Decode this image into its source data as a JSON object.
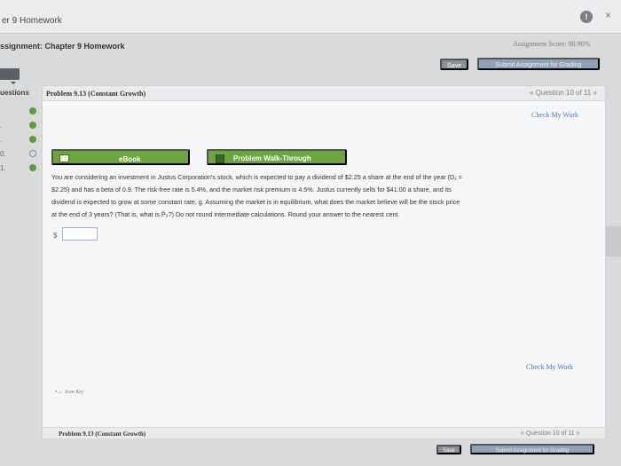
{
  "window": {
    "title": "er 9 Homework"
  },
  "header": {
    "assignment_title": "ssignment: Chapter 9 Homework",
    "assignment_score": "Assignment Score: 90.90%",
    "save_label": "Save",
    "submit_label": "Submit Assignment for Grading"
  },
  "icons": {
    "toc": "toc-icon",
    "info": "info-icon",
    "close": "close-icon"
  },
  "sidebar": {
    "header": "uestions",
    "items": [
      {
        "num": "",
        "status": "correct"
      },
      {
        "num": ".",
        "status": "correct"
      },
      {
        "num": ".",
        "status": "correct"
      },
      {
        "num": "0.",
        "status": "incomplete"
      },
      {
        "num": "1.",
        "status": "correct"
      }
    ]
  },
  "problem": {
    "title": "Problem 9.13 (Constant Growth)",
    "question_nav": "« Question 10 of 11 »",
    "check_work": "Check My Work",
    "ebook_label": "eBook",
    "walkthrough_label": "Problem Walk-Through",
    "question_lines": [
      "You are considering an investment in Justus Corporation's stock, which is expected to pay a dividend of $2.25 a share at the end of the year (D₁ =",
      "$2.25) and has a beta of 0.9. The risk-free rate is 5.4%, and the market risk premium is 4.5%. Justus currently sells for $41.00 a share, and its",
      "dividend is expected to grow at some constant rate, g. Assuming the market is in equilibrium, what does the market believe will be the stock price",
      "at the end of 3 years? (That is, what is P̂₃?) Do not round intermediate calculations. Round your answer to the nearest cent."
    ],
    "answer_prefix": "$",
    "answer_value": "",
    "check_work_bottom": "Check My Work",
    "item_key": "Icon Key",
    "footer_title": "Problem 9.13 (Constant Growth)",
    "footer_nav": "« Question 10 of 11 »",
    "save_label": "Save",
    "submit_label": "Submit Assignment for Grading"
  },
  "colors": {
    "brand_green": "#6da43f",
    "link_blue": "#4b79b2",
    "submit_blue": "#8fa1b7",
    "save_gray": "#8b8f97",
    "status_green": "#5a9f3c"
  }
}
